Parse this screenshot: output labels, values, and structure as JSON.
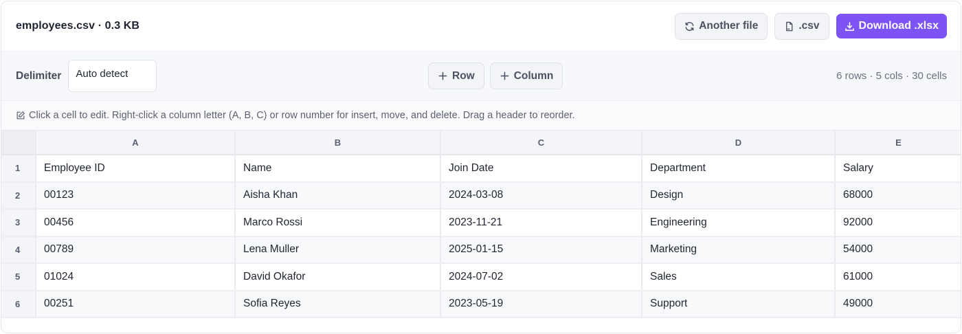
{
  "file": {
    "title": "employees.csv · 0.3 KB"
  },
  "actions": {
    "another_file": "Another file",
    "csv": ".csv",
    "download": "Download .xlsx"
  },
  "toolbar": {
    "delimiter_label": "Delimiter",
    "delimiter_value": "Auto detect",
    "add_row": "Row",
    "add_column": "Column",
    "stats": "6 rows · 5 cols · 30 cells"
  },
  "hint": "Click a cell to edit. Right-click a column letter (A, B, C) or row number for insert, move, and delete. Drag a header to reorder.",
  "grid": {
    "columns": [
      "A",
      "B",
      "C",
      "D",
      "E"
    ],
    "rows": [
      {
        "num": "1",
        "cells": [
          "Employee ID",
          "Name",
          "Join Date",
          "Department",
          "Salary"
        ]
      },
      {
        "num": "2",
        "cells": [
          "00123",
          "Aisha Khan",
          "2024-03-08",
          "Design",
          "68000"
        ]
      },
      {
        "num": "3",
        "cells": [
          "00456",
          "Marco Rossi",
          "2023-11-21",
          "Engineering",
          "92000"
        ]
      },
      {
        "num": "4",
        "cells": [
          "00789",
          "Lena Muller",
          "2025-01-15",
          "Marketing",
          "54000"
        ]
      },
      {
        "num": "5",
        "cells": [
          "01024",
          "David Okafor",
          "2024-07-02",
          "Sales",
          "61000"
        ]
      },
      {
        "num": "6",
        "cells": [
          "00251",
          "Sofia Reyes",
          "2023-05-19",
          "Support",
          "49000"
        ]
      }
    ]
  },
  "colors": {
    "accent": "#7d53f5"
  }
}
